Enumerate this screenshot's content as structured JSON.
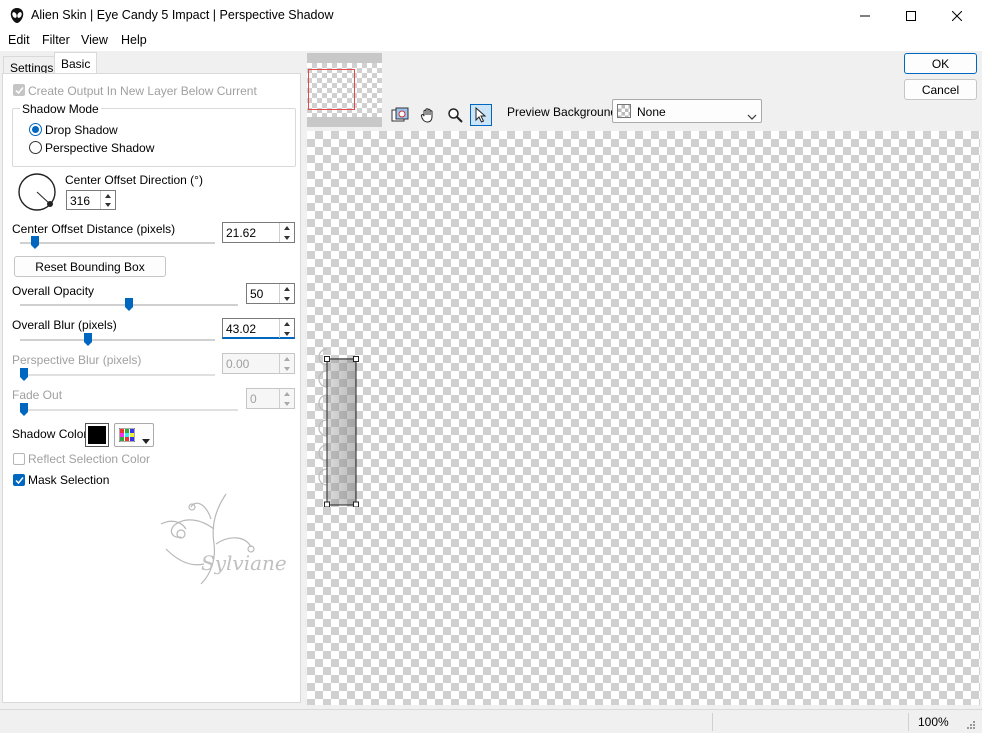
{
  "window": {
    "title": "Alien Skin | Eye Candy 5 Impact | Perspective Shadow"
  },
  "menu": [
    "Edit",
    "Filter",
    "View",
    "Help"
  ],
  "tabs": {
    "settings": "Settings",
    "basic": "Basic"
  },
  "basic": {
    "create_output_label": "Create Output In New Layer Below Current",
    "create_output_checked": true,
    "shadow_mode": {
      "label": "Shadow Mode",
      "options": [
        "Drop Shadow",
        "Perspective Shadow"
      ],
      "selected": "Drop Shadow"
    },
    "direction": {
      "label": "Center Offset Direction (°)",
      "value": "316"
    },
    "distance": {
      "label": "Center Offset Distance (pixels)",
      "value": "21.62"
    },
    "reset_button": "Reset Bounding Box",
    "opacity": {
      "label": "Overall Opacity",
      "value": "50"
    },
    "blur": {
      "label": "Overall Blur (pixels)",
      "value": "43.02"
    },
    "perspective_blur": {
      "label": "Perspective Blur (pixels)",
      "value": "0.00"
    },
    "fade_out": {
      "label": "Fade Out",
      "value": "0"
    },
    "shadow_color": {
      "label": "Shadow Color",
      "color": "#000000"
    },
    "reflect_selection": {
      "label": "Reflect Selection Color",
      "checked": false
    },
    "mask_selection": {
      "label": "Mask Selection",
      "checked": true
    },
    "watermark": "Sylviane"
  },
  "buttons": {
    "ok": "OK",
    "cancel": "Cancel"
  },
  "preview": {
    "background_label": "Preview Background:",
    "background_value": "None"
  },
  "status": {
    "zoom": "100%"
  },
  "icons": [
    "alien-skin-logo-icon",
    "minimize-icon",
    "maximize-icon",
    "close-icon",
    "navigator-icon",
    "hand-icon",
    "zoom-icon",
    "pointer-icon",
    "chevron-down-icon",
    "color-palette-icon"
  ]
}
